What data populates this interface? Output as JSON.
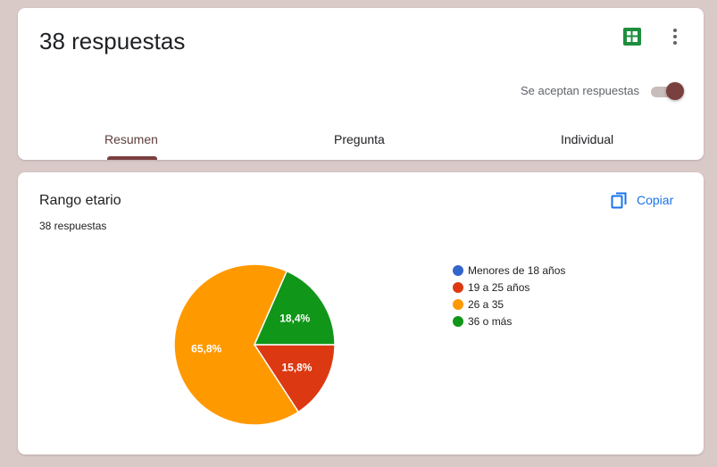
{
  "header": {
    "title": "38 respuestas",
    "accepting_label": "Se aceptan respuestas",
    "accepting_responses": true
  },
  "tabs": [
    {
      "label": "Resumen",
      "active": true
    },
    {
      "label": "Pregunta",
      "active": false
    },
    {
      "label": "Individual",
      "active": false
    }
  ],
  "question": {
    "title": "Rango etario",
    "count_label": "38 respuestas",
    "copy_label": "Copiar"
  },
  "colors": {
    "accent": "#7a3f3f",
    "link": "#1a73e8",
    "sheets": "#1e8e3e"
  },
  "icons": {
    "sheets": "sheets-icon",
    "more": "more-vert-icon",
    "copy": "copy-icon"
  },
  "chart_data": {
    "type": "pie",
    "categories": [
      "Menores de 18 años",
      "19 a 25 años",
      "26 a 35",
      "36 o más"
    ],
    "values": [
      0,
      15.8,
      65.8,
      18.4
    ],
    "labels": [
      "",
      "15,8%",
      "65,8%",
      "18,4%"
    ],
    "colors": [
      "#3366cc",
      "#dc3912",
      "#ff9900",
      "#109618"
    ],
    "legend": "right"
  }
}
